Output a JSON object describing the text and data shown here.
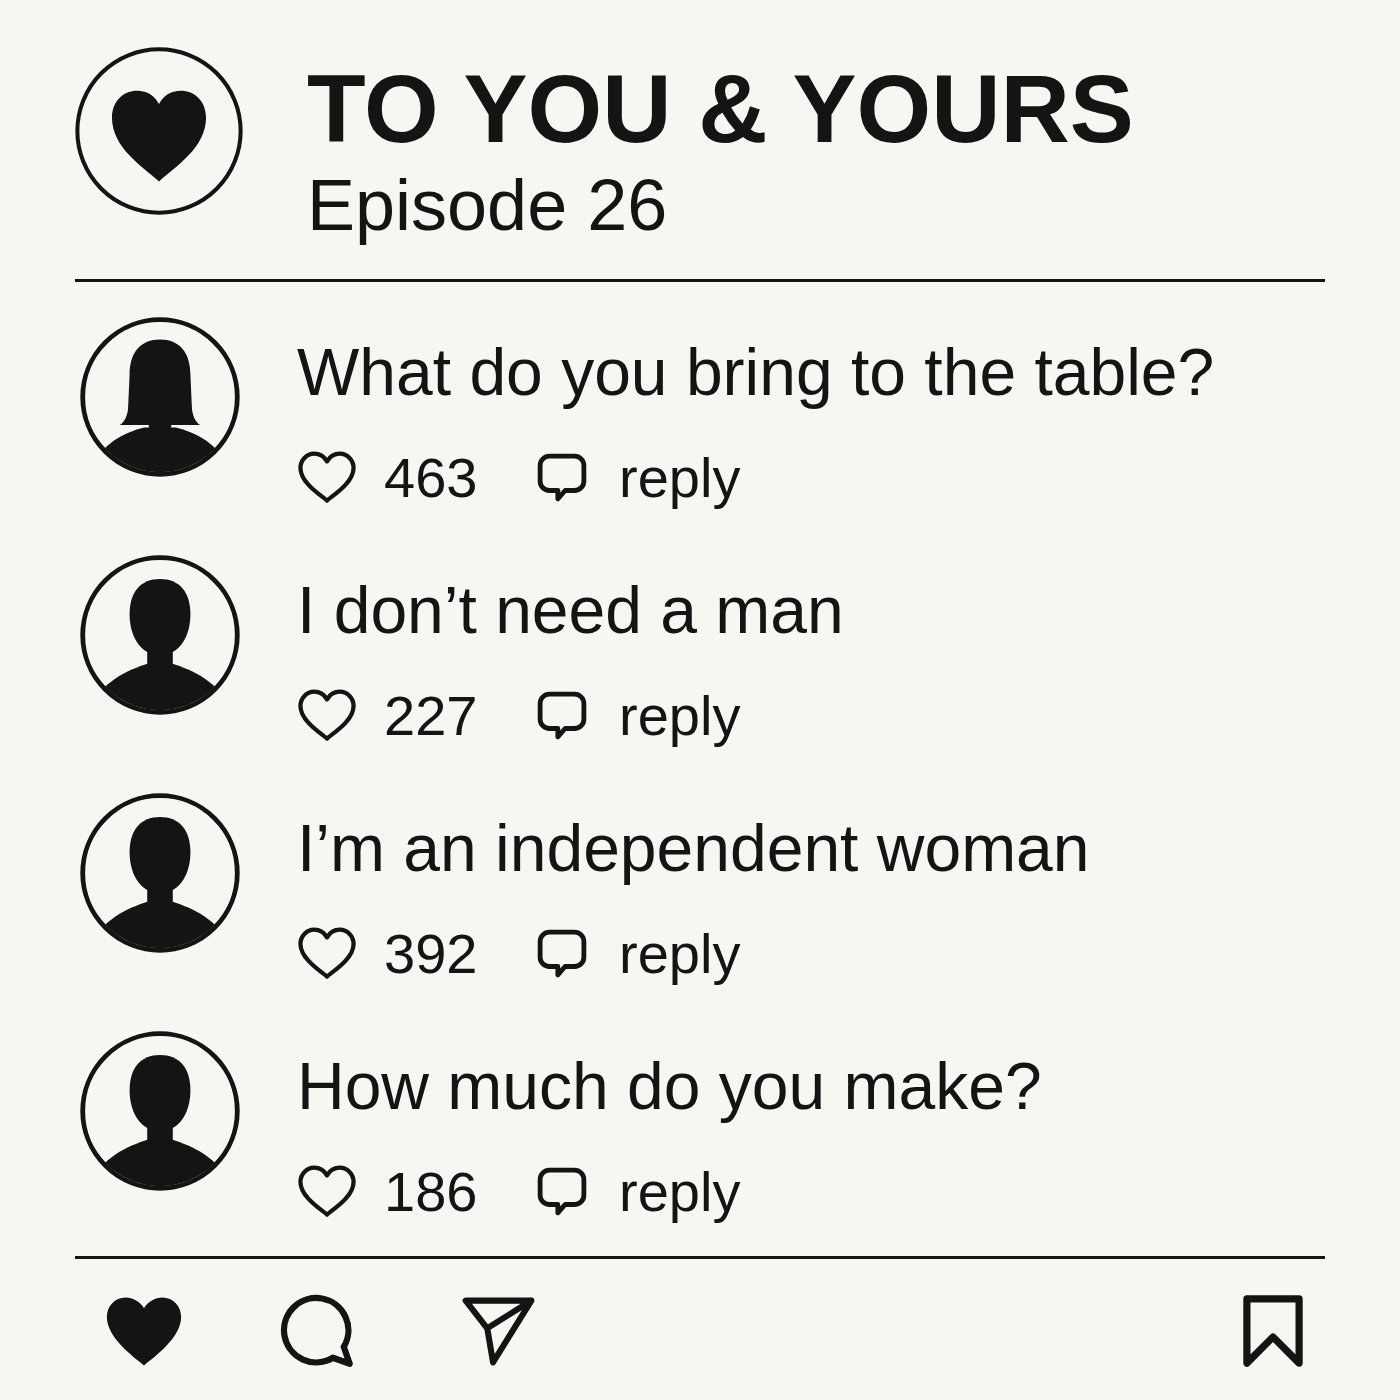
{
  "header": {
    "title": "TO YOU & YOURS",
    "subtitle": "Episode 26"
  },
  "comments": [
    {
      "avatar": {
        "kind": "bob"
      },
      "text": "What do you bring to the table?",
      "likes": "463",
      "reply": "reply"
    },
    {
      "avatar": {
        "kind": "short"
      },
      "text": "I don’t need a man",
      "likes": "227",
      "reply": "reply"
    },
    {
      "avatar": {
        "kind": "short"
      },
      "text": "I’m an independent woman",
      "likes": "392",
      "reply": "reply"
    },
    {
      "avatar": {
        "kind": "short"
      },
      "text": "How much do you make?",
      "likes": "186",
      "reply": "reply"
    }
  ],
  "actions": [
    {
      "kind": "like"
    },
    {
      "kind": "comment"
    },
    {
      "kind": "share"
    },
    {
      "kind": "bookmark"
    }
  ]
}
